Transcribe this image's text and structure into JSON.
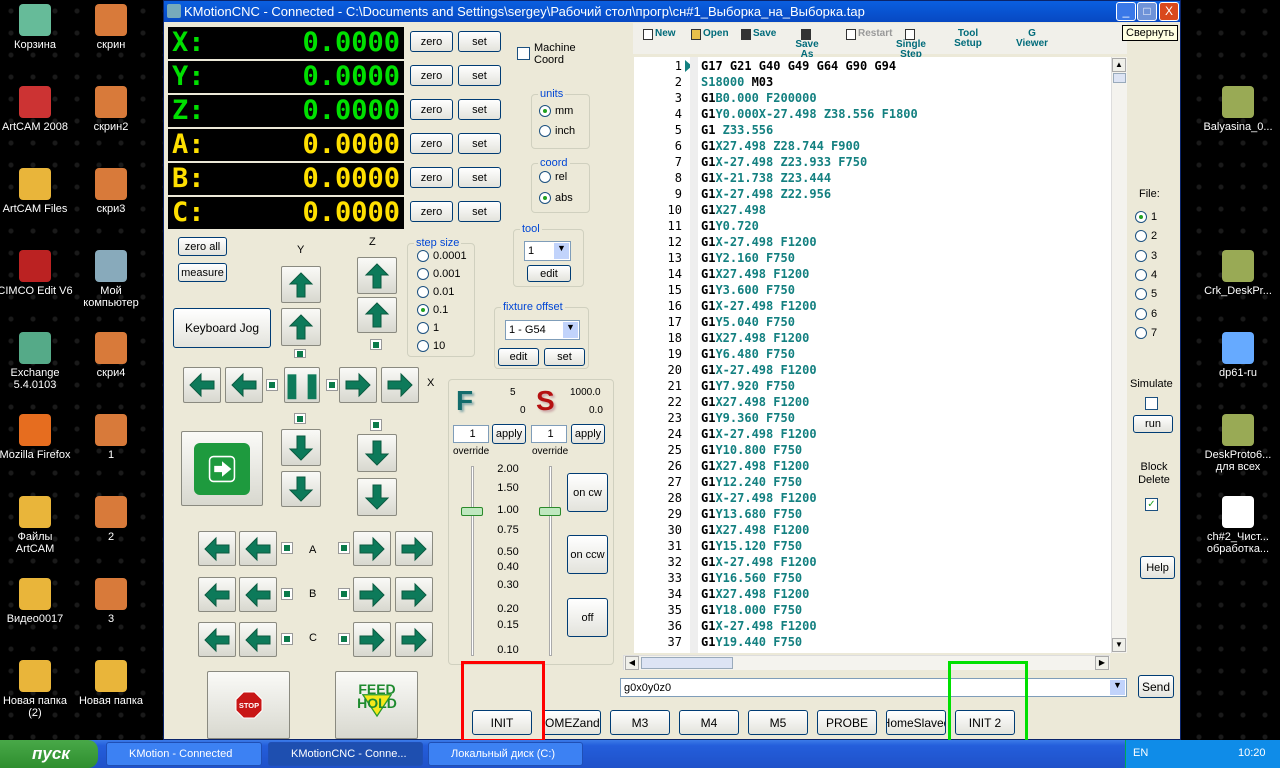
{
  "window": {
    "title": "KMotionCNC - Connected - C:\\Documents and Settings\\sergey\\Рабочий стол\\прогр\\сн#1_Выборка_на_Выборка.tap",
    "minimize": "_",
    "maximize": "□",
    "close": "X",
    "tooltip": "Свернуть"
  },
  "dro": [
    {
      "axis": "X:",
      "value": "0.0000"
    },
    {
      "axis": "Y:",
      "value": "0.0000"
    },
    {
      "axis": "Z:",
      "value": "0.0000"
    },
    {
      "axis": "A:",
      "value": "0.0000"
    },
    {
      "axis": "B:",
      "value": "0.0000"
    },
    {
      "axis": "C:",
      "value": "0.0000"
    }
  ],
  "dro_colors": {
    "xyz": "#00e000",
    "abc": "#ffe000"
  },
  "zero_label": "zero",
  "set_label": "set",
  "machine_coord": {
    "label": "Machine Coord",
    "checked": false
  },
  "units": {
    "label": "units",
    "options": [
      "mm",
      "inch"
    ],
    "selected": "mm"
  },
  "coord": {
    "label": "coord",
    "options": [
      "rel",
      "abs"
    ],
    "selected": "abs"
  },
  "tool": {
    "label": "tool",
    "value": "1",
    "edit": "edit"
  },
  "fixture": {
    "label": "fixture offset",
    "value": "1 - G54",
    "edit": "edit",
    "set": "set"
  },
  "step_size": {
    "label": "step size",
    "options": [
      "0.0001",
      "0.001",
      "0.01",
      "0.1",
      "1",
      "10"
    ],
    "selected": "0.1"
  },
  "zero_all": "zero all",
  "measure": "measure",
  "keyboard_jog": "Keyboard Jog",
  "jog_labels": {
    "y": "Y",
    "z": "Z",
    "x": "X",
    "a": "A",
    "b": "B",
    "c": "C"
  },
  "feed": {
    "letter": "F",
    "value1": "5",
    "value2": "0",
    "override_value": "1",
    "apply": "apply",
    "override": "override",
    "override_level": 1.0
  },
  "spindle": {
    "letter": "S",
    "value1": "1000.0",
    "value2": "0.0",
    "override_value": "1",
    "apply": "apply",
    "override": "override",
    "override_level": 1.0
  },
  "scale": [
    "2.00",
    "1.50",
    "1.00",
    "0.75",
    "0.50",
    "0.40",
    "0.30",
    "0.20",
    "0.15",
    "0.10"
  ],
  "spindle_buttons": [
    "on cw",
    "on ccw",
    "off"
  ],
  "stop": "STOP",
  "feedhold": "FEED HOLD",
  "toolbar": [
    {
      "label": "New",
      "icon": "new-file-icon"
    },
    {
      "label": "Open",
      "icon": "open-folder-icon"
    },
    {
      "label": "Save",
      "icon": "floppy-icon"
    },
    {
      "label": "Save As",
      "icon": "floppy-icon"
    },
    {
      "label": "Restart",
      "icon": "rewind-icon",
      "disabled": true
    },
    {
      "label": "Single Step",
      "icon": "step-icon"
    },
    {
      "label": "Tool Setup"
    },
    {
      "label": "G Viewer"
    }
  ],
  "code": [
    [
      [
        "G17 G21 G40 G49 G64 G90 G94",
        "c"
      ]
    ],
    [
      [
        "S18000",
        "v"
      ],
      [
        " M03",
        "c"
      ]
    ],
    [
      [
        "G1",
        "c"
      ],
      [
        "B0.000 F200000",
        "v"
      ]
    ],
    [
      [
        "G1",
        "c"
      ],
      [
        "Y0.000X-27.498 Z38.556 F1800",
        "v"
      ]
    ],
    [
      [
        "G1",
        "c"
      ],
      [
        " Z33.556",
        "v"
      ]
    ],
    [
      [
        "G1",
        "c"
      ],
      [
        "X27.498 Z28.744 F900",
        "v"
      ]
    ],
    [
      [
        "G1",
        "c"
      ],
      [
        "X-27.498 Z23.933 F750",
        "v"
      ]
    ],
    [
      [
        "G1",
        "c"
      ],
      [
        "X-21.738 Z23.444",
        "v"
      ]
    ],
    [
      [
        "G1",
        "c"
      ],
      [
        "X-27.498 Z22.956",
        "v"
      ]
    ],
    [
      [
        "G1",
        "c"
      ],
      [
        "X27.498",
        "v"
      ]
    ],
    [
      [
        "G1",
        "c"
      ],
      [
        "Y0.720",
        "v"
      ]
    ],
    [
      [
        "G1",
        "c"
      ],
      [
        "X-27.498 F1200",
        "v"
      ]
    ],
    [
      [
        "G1",
        "c"
      ],
      [
        "Y2.160 F750",
        "v"
      ]
    ],
    [
      [
        "G1",
        "c"
      ],
      [
        "X27.498 F1200",
        "v"
      ]
    ],
    [
      [
        "G1",
        "c"
      ],
      [
        "Y3.600 F750",
        "v"
      ]
    ],
    [
      [
        "G1",
        "c"
      ],
      [
        "X-27.498 F1200",
        "v"
      ]
    ],
    [
      [
        "G1",
        "c"
      ],
      [
        "Y5.040 F750",
        "v"
      ]
    ],
    [
      [
        "G1",
        "c"
      ],
      [
        "X27.498 F1200",
        "v"
      ]
    ],
    [
      [
        "G1",
        "c"
      ],
      [
        "Y6.480 F750",
        "v"
      ]
    ],
    [
      [
        "G1",
        "c"
      ],
      [
        "X-27.498 F1200",
        "v"
      ]
    ],
    [
      [
        "G1",
        "c"
      ],
      [
        "Y7.920 F750",
        "v"
      ]
    ],
    [
      [
        "G1",
        "c"
      ],
      [
        "X27.498 F1200",
        "v"
      ]
    ],
    [
      [
        "G1",
        "c"
      ],
      [
        "Y9.360 F750",
        "v"
      ]
    ],
    [
      [
        "G1",
        "c"
      ],
      [
        "X-27.498 F1200",
        "v"
      ]
    ],
    [
      [
        "G1",
        "c"
      ],
      [
        "Y10.800 F750",
        "v"
      ]
    ],
    [
      [
        "G1",
        "c"
      ],
      [
        "X27.498 F1200",
        "v"
      ]
    ],
    [
      [
        "G1",
        "c"
      ],
      [
        "Y12.240 F750",
        "v"
      ]
    ],
    [
      [
        "G1",
        "c"
      ],
      [
        "X-27.498 F1200",
        "v"
      ]
    ],
    [
      [
        "G1",
        "c"
      ],
      [
        "Y13.680 F750",
        "v"
      ]
    ],
    [
      [
        "G1",
        "c"
      ],
      [
        "X27.498 F1200",
        "v"
      ]
    ],
    [
      [
        "G1",
        "c"
      ],
      [
        "Y15.120 F750",
        "v"
      ]
    ],
    [
      [
        "G1",
        "c"
      ],
      [
        "X-27.498 F1200",
        "v"
      ]
    ],
    [
      [
        "G1",
        "c"
      ],
      [
        "Y16.560 F750",
        "v"
      ]
    ],
    [
      [
        "G1",
        "c"
      ],
      [
        "X27.498 F1200",
        "v"
      ]
    ],
    [
      [
        "G1",
        "c"
      ],
      [
        "Y18.000 F750",
        "v"
      ]
    ],
    [
      [
        "G1",
        "c"
      ],
      [
        "X-27.498 F1200",
        "v"
      ]
    ],
    [
      [
        "G1",
        "c"
      ],
      [
        "Y19.440 F750",
        "v"
      ]
    ]
  ],
  "mdi": {
    "value": "g0x0y0z0",
    "send": "Send"
  },
  "file": {
    "label": "File:",
    "options": [
      "1",
      "2",
      "3",
      "4",
      "5",
      "6",
      "7"
    ],
    "selected": "1"
  },
  "simulate": {
    "label": "Simulate",
    "checked": false,
    "run": "run"
  },
  "block_delete": {
    "label": "Block Delete",
    "checked": true
  },
  "help": "Help",
  "user_buttons": [
    "INIT",
    "HOMEZand>",
    "M3",
    "M4",
    "M5",
    "PROBE",
    "HomeSlaved",
    "INIT 2"
  ],
  "highlight_colors": {
    "red": "#ff0000",
    "green": "#00e000"
  },
  "desktop_left": [
    {
      "label": "Корзина"
    },
    {
      "label": "ArtCAM 2008"
    },
    {
      "label": "ArtCAM Files"
    },
    {
      "label": "CIMCO Edit V6"
    },
    {
      "label": "Exchange 5.4.0103"
    },
    {
      "label": "Mozilla Firefox"
    },
    {
      "label": "Файлы ArtCAM"
    },
    {
      "label": "Видео0017"
    },
    {
      "label": "Новая папка (2)"
    }
  ],
  "desktop_left2": [
    {
      "label": "скрин"
    },
    {
      "label": "скрин2"
    },
    {
      "label": "скри3"
    },
    {
      "label": "Мой компьютер"
    },
    {
      "label": "скри4"
    },
    {
      "label": "1"
    },
    {
      "label": "2"
    },
    {
      "label": "3"
    },
    {
      "label": "Новая папка"
    }
  ],
  "desktop_right": [
    {
      "label": "Balyasina_0..."
    },
    {
      "label": "Crk_DeskPr..."
    },
    {
      "label": "dp61-ru"
    },
    {
      "label": "DeskProto6... для всех"
    },
    {
      "label": "ch#2_Чист... обработка..."
    }
  ],
  "taskbar": {
    "start": "пуск",
    "tasks": [
      "KMotion - Connected",
      "KMotionCNC - Conne...",
      "Локальный диск (C:)"
    ],
    "lang": "EN",
    "time": "10:20"
  }
}
